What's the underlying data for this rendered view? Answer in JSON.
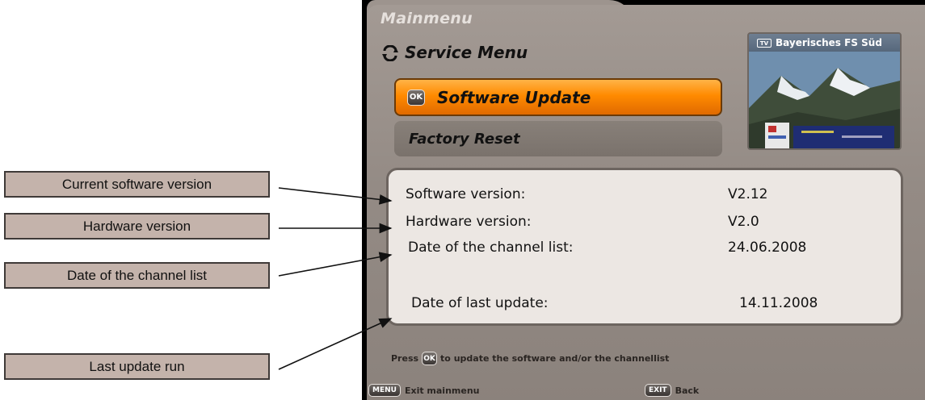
{
  "callouts": [
    "Current software version",
    "Hardware version",
    "Date of the channel list",
    "Last update run"
  ],
  "screen": {
    "breadcrumb": "Mainmenu",
    "submenu_title": "Service Menu",
    "menu_items": [
      {
        "label": "Software Update",
        "selected": true,
        "key": "OK"
      },
      {
        "label": "Factory Reset",
        "selected": false
      }
    ],
    "preview": {
      "badge": "TV",
      "channel": "Bayerisches FS Süd"
    },
    "info_rows": [
      {
        "label": "Software version:",
        "value": "V2.12"
      },
      {
        "label": "Hardware version:",
        "value": "V2.0"
      },
      {
        "label": "Date of the channel list:",
        "value": "24.06.2008"
      },
      {
        "label": "Date of last update:",
        "value": "14.11.2008"
      }
    ],
    "hint": {
      "prefix": "Press",
      "key": "OK",
      "suffix": "to update the software and/or the channellist"
    },
    "footer": [
      {
        "key": "MENU",
        "label": "Exit mainmenu"
      },
      {
        "key": "EXIT",
        "label": "Back"
      }
    ]
  },
  "colors": {
    "selected_item": "#ff8a00",
    "callout_bg": "#c4b3ab",
    "panel_bg": "#948b85",
    "info_bg": "#ece7e3"
  }
}
